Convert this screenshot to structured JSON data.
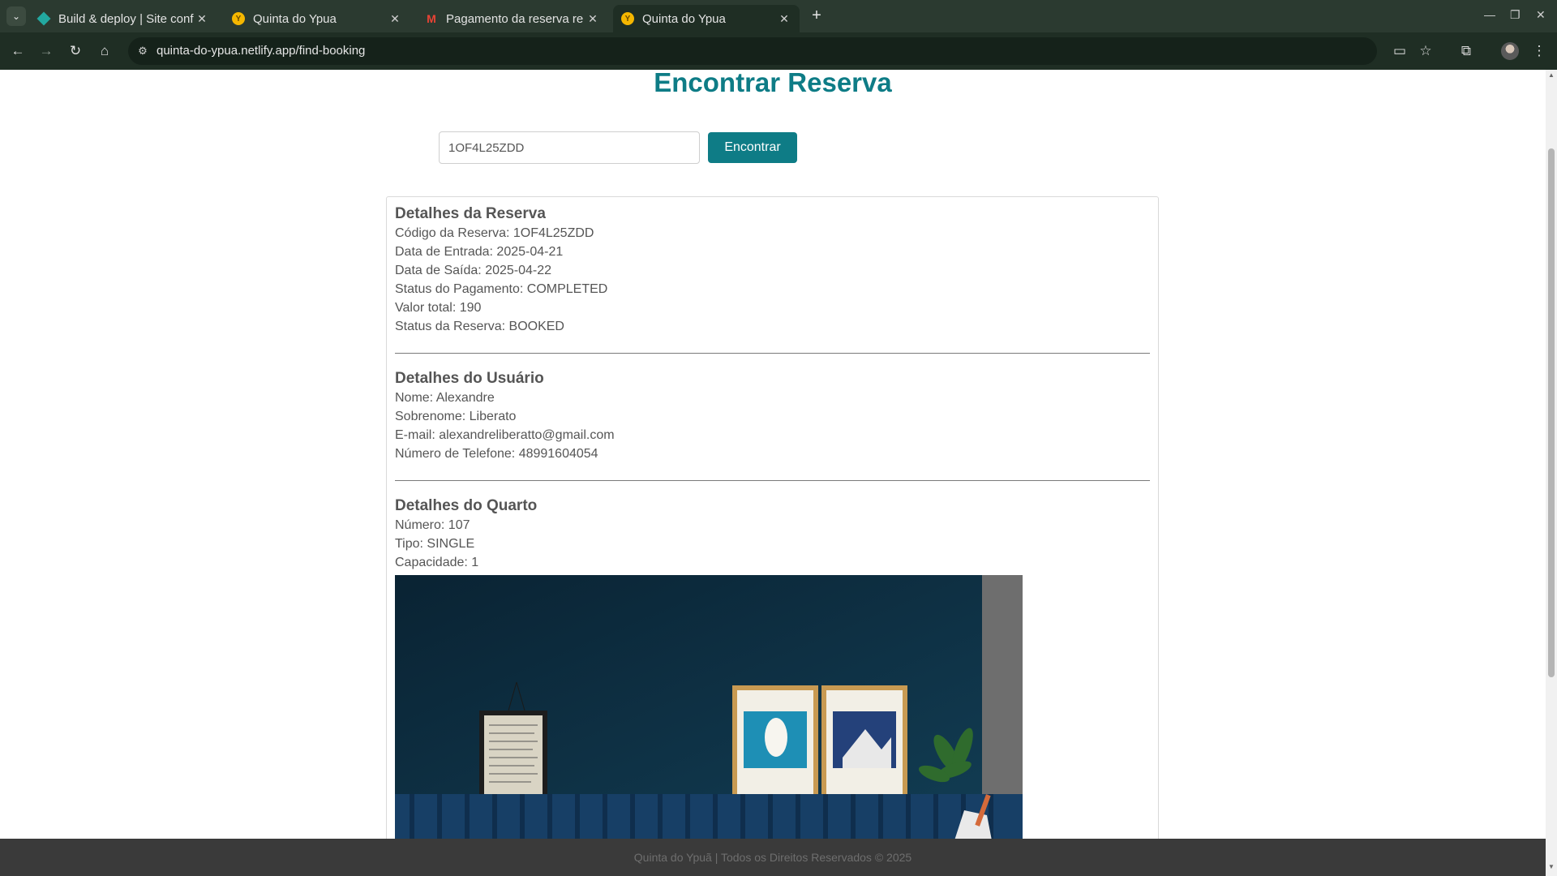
{
  "browser": {
    "tabs": [
      {
        "title": "Build & deploy | Site conf",
        "favicon": "netlify-diamond-icon",
        "active": false
      },
      {
        "title": "Quinta do Ypua",
        "favicon": "quinta-logo-icon",
        "active": false
      },
      {
        "title": "Pagamento da reserva re",
        "favicon": "gmail-icon",
        "active": false
      },
      {
        "title": "Quinta do Ypua",
        "favicon": "quinta-logo-icon",
        "active": true
      }
    ],
    "url": "quinta-do-ypua.netlify.app/find-booking"
  },
  "page": {
    "title": "Encontrar Reserva",
    "search": {
      "value": "1OF4L25ZDD",
      "button_label": "Encontrar"
    },
    "booking": {
      "heading": "Detalhes da Reserva",
      "code": "Código da Reserva: 1OF4L25ZDD",
      "check_in": "Data de Entrada: 2025-04-21",
      "check_out": "Data de Saída: 2025-04-22",
      "payment_status": "Status do Pagamento: COMPLETED",
      "total": "Valor total: 190",
      "status": "Status da Reserva: BOOKED"
    },
    "user": {
      "heading": "Detalhes do Usuário",
      "first_name": "Nome: Alexandre",
      "last_name": "Sobrenome: Liberato",
      "email": "E-mail: alexandreliberatto@gmail.com",
      "phone": "Número de Telefone: 48991604054"
    },
    "room": {
      "heading": "Detalhes do Quarto",
      "number": "Número: 107",
      "type": "Tipo: SINGLE",
      "capacity": "Capacidade: 1"
    },
    "footer": "Quinta do Ypuã | Todos os Direitos Reservados © 2025"
  },
  "colors": {
    "accent": "#0e7c86",
    "text": "#555555",
    "footer_bg": "#3a3a3a",
    "chrome_bg": "#2b3a30"
  }
}
